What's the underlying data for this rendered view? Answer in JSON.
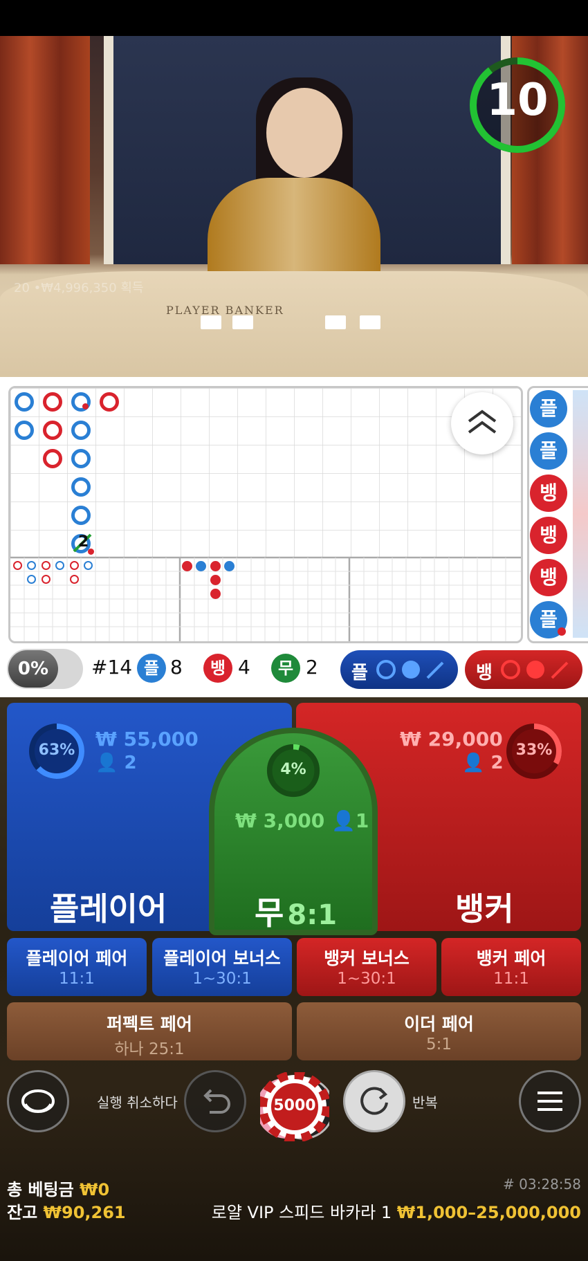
{
  "video": {
    "timer": "10",
    "overlay": "20 •₩4,996,350 획득",
    "table_text": "PLAYER         BANKER"
  },
  "stats": {
    "percent_toggle": "0%",
    "round": "#14",
    "player_glyph": "플",
    "player_count": "8",
    "banker_glyph": "뱅",
    "banker_count": "4",
    "tie_glyph": "무",
    "tie_count": "2",
    "predict_player": "플",
    "predict_banker": "뱅"
  },
  "road": {
    "cell_marker": "2",
    "beads": [
      "플",
      "플",
      "뱅",
      "뱅",
      "뱅",
      "플"
    ]
  },
  "bets": {
    "player": {
      "label": "플레이어",
      "amount": "₩ 55,000",
      "players": "2",
      "percent": "63%",
      "percent_value": 63
    },
    "tie": {
      "label": "무",
      "odds": "8:1",
      "amount": "₩ 3,000",
      "players": "1",
      "percent": "4%",
      "percent_value": 4
    },
    "banker": {
      "label": "뱅커",
      "amount": "₩ 29,000",
      "players": "2",
      "percent": "33%",
      "percent_value": 33
    },
    "side": [
      {
        "label": "플레이어 페어",
        "odds": "11:1"
      },
      {
        "label": "플레이어 보너스",
        "odds": "1~30:1"
      },
      {
        "label": "뱅커 보너스",
        "odds": "1~30:1"
      },
      {
        "label": "뱅커 페어",
        "odds": "11:1"
      }
    ],
    "perfect": {
      "label": "퍼펙트 페어",
      "odds": "하나 25:1"
    },
    "either": {
      "label": "이더 페어",
      "odds": "5:1"
    }
  },
  "controls": {
    "undo_label": "실행 취소하다",
    "repeat_label": "반복",
    "chip_value": "5000"
  },
  "footer": {
    "total_bet_label": "총 베팅금",
    "total_bet": "₩0",
    "balance_label": "잔고",
    "balance": "₩90,261",
    "time": "# 03:28:58",
    "table_name": "로얄 VIP 스피드 바카라 1",
    "limits": "₩1,000–25,000,000"
  },
  "colors": {
    "player": "#2357c9",
    "banker": "#d42626",
    "tie": "#2f8a2f",
    "gold": "#f0c234"
  }
}
